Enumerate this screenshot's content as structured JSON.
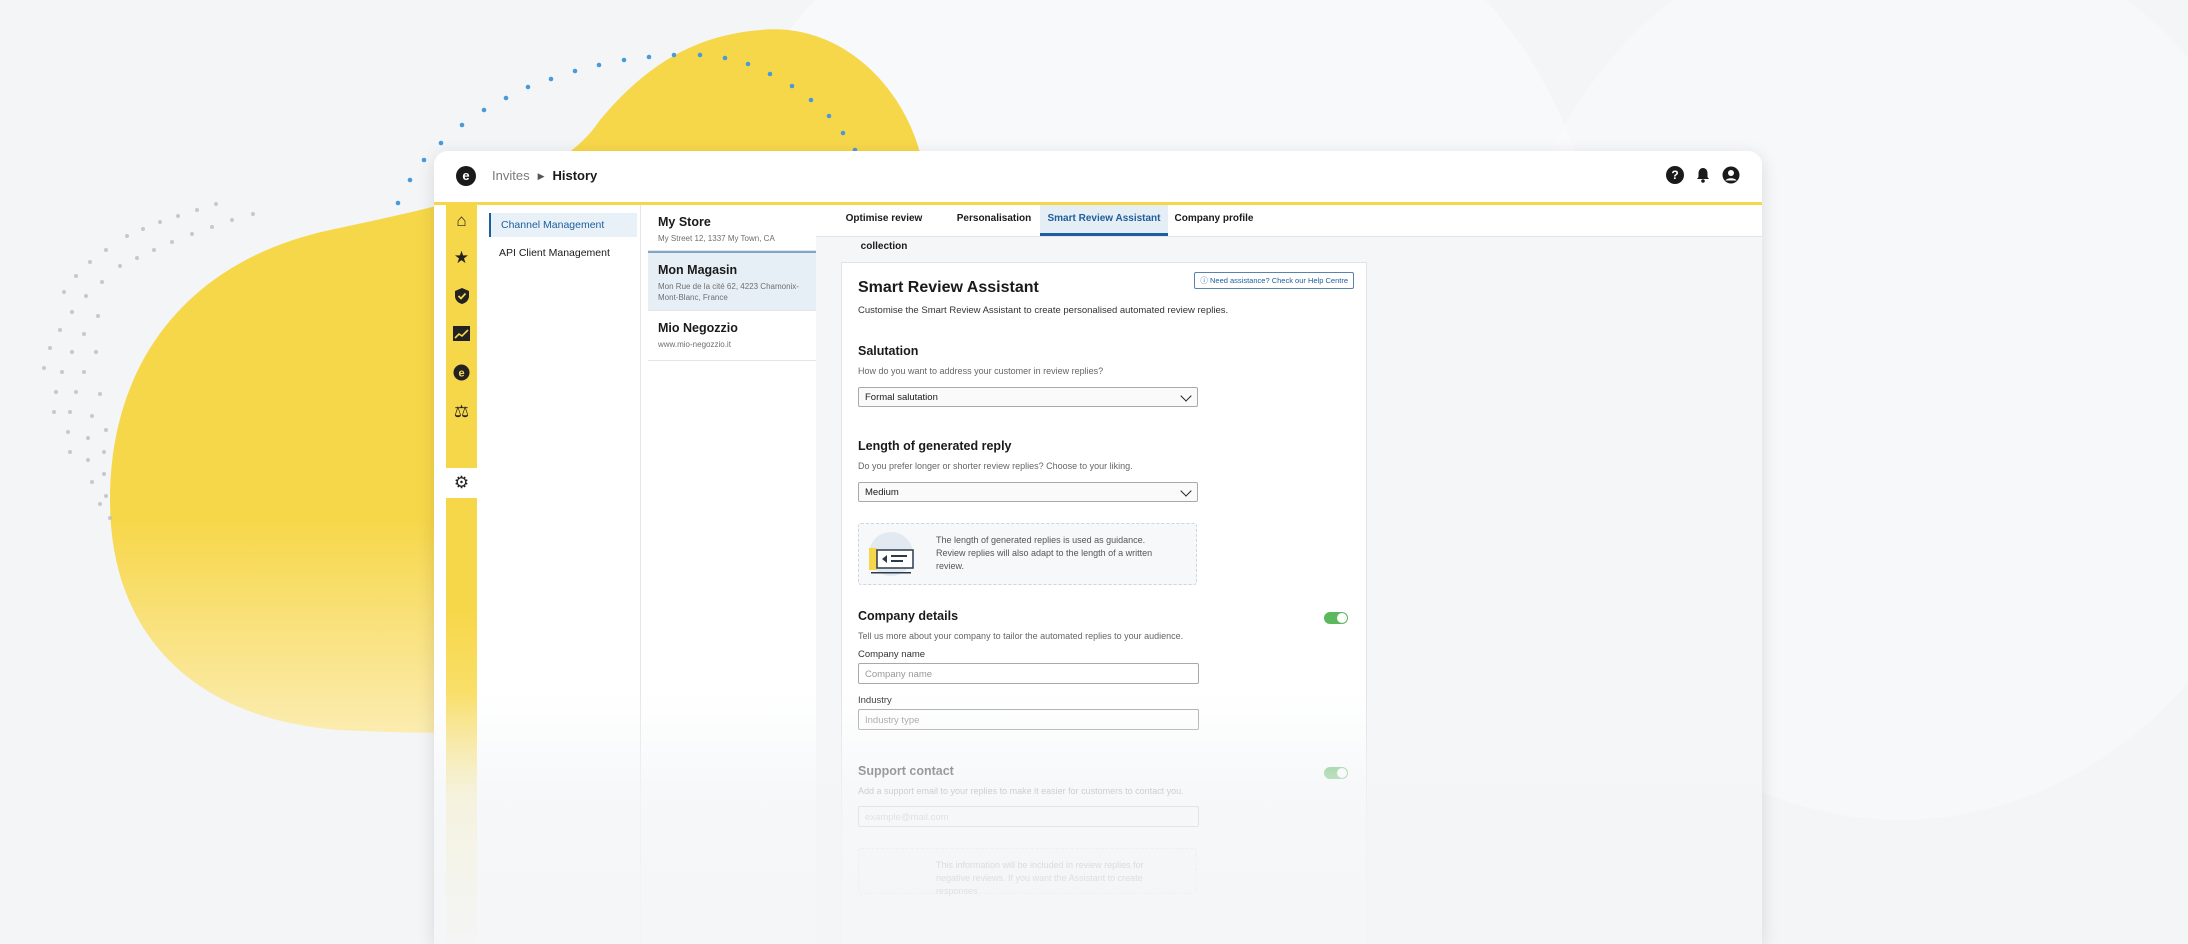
{
  "breadcrumb": {
    "parent": "Invites",
    "current": "History"
  },
  "icons": {
    "logo": "brand-logo",
    "help": "help-icon",
    "notifications": "bell-icon",
    "account": "user-icon"
  },
  "colors": {
    "accent_yellow": "#f7d74a",
    "brand_blue": "#1d5e9c",
    "toggle_green": "#5cb85c"
  },
  "navrail": [
    "home-icon",
    "star-icon",
    "shield-icon",
    "chart-icon",
    "brand-icon",
    "scales-icon",
    "gear-icon"
  ],
  "subnav": [
    {
      "label": "Channel Management",
      "active": true
    },
    {
      "label": "API Client Management",
      "active": false
    }
  ],
  "stores": [
    {
      "name": "My Store",
      "address": "My Street 12, 1337 My Town, CA"
    },
    {
      "name": "Mon Magasin",
      "address": "Mon Rue de la cité 62, 4223 Chamonix-Mont-Blanc, France"
    },
    {
      "name": "Mio Negozzio",
      "address": "www.mio-negozzio.it"
    }
  ],
  "tabs": [
    {
      "label": "Optimise review collection"
    },
    {
      "label": "Personalisation"
    },
    {
      "label": "Smart Review Assistant",
      "active": true
    },
    {
      "label": "Company profile"
    }
  ],
  "card": {
    "help_link": "Need assistance? Check our Help Centre",
    "title": "Smart Review Assistant",
    "description": "Customise the Smart Review Assistant to create personalised automated review replies.",
    "salutation": {
      "title": "Salutation",
      "question": "How do you want to address your customer in review replies?",
      "value": "Formal salutation"
    },
    "length": {
      "title": "Length of generated reply",
      "question": "Do you prefer longer or shorter review replies? Choose to your liking.",
      "value": "Medium",
      "info": "The length of generated replies is used as guidance. Review replies will also adapt to the length of a written review."
    },
    "company": {
      "title": "Company details",
      "question": "Tell us more about your company to tailor the automated replies to your audience.",
      "name_label": "Company name",
      "name_placeholder": "Company name",
      "industry_label": "Industry",
      "industry_placeholder": "Industry type"
    },
    "support": {
      "title": "Support contact",
      "question": "Add a support email to your replies to make it easier for customers to contact you.",
      "email_placeholder": "example@mail.com",
      "info": "This information will be included in review replies for negative reviews. If you want the Assistant to create responses"
    }
  }
}
